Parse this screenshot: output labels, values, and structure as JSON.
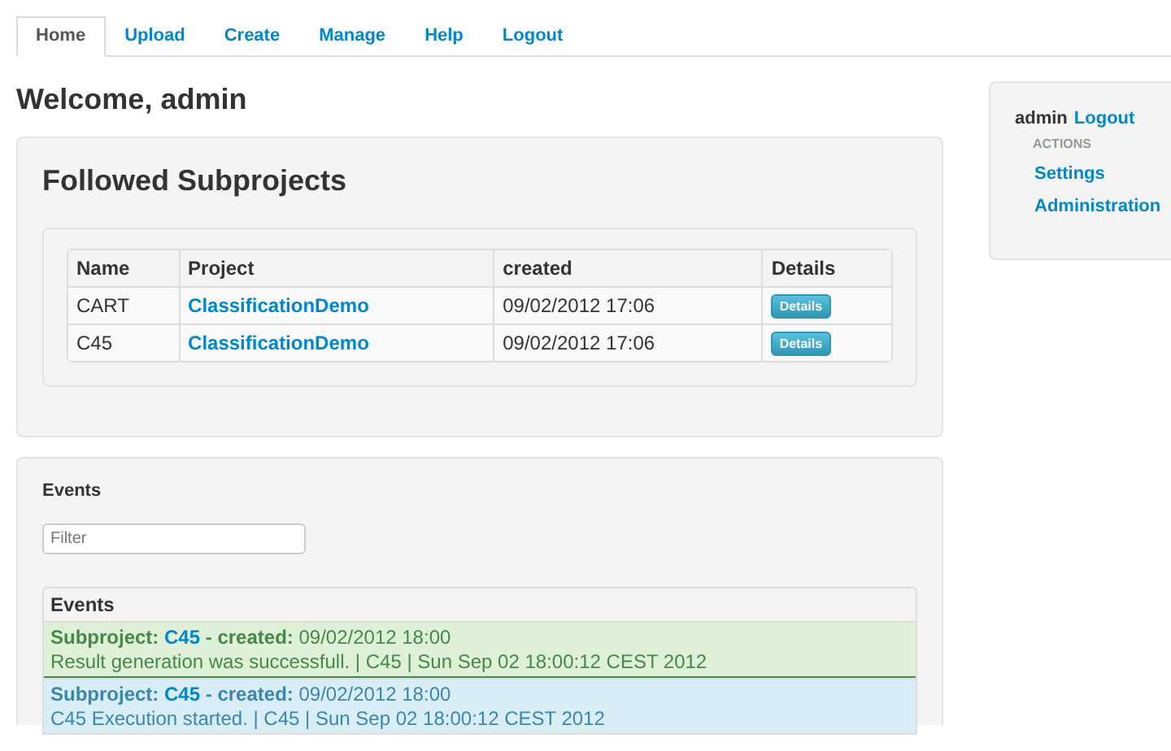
{
  "nav": {
    "tabs": [
      {
        "label": "Home",
        "selected": true
      },
      {
        "label": "Upload",
        "selected": false
      },
      {
        "label": "Create",
        "selected": false
      },
      {
        "label": "Manage",
        "selected": false
      },
      {
        "label": "Help",
        "selected": false
      },
      {
        "label": "Logout",
        "selected": false
      }
    ]
  },
  "heading": "Welcome, admin",
  "followed": {
    "title": "Followed Subprojects",
    "columns": [
      "Name",
      "Project",
      "created",
      "Details"
    ],
    "rows": [
      {
        "name": "CART",
        "project": "ClassificationDemo",
        "created": "09/02/2012 17:06",
        "button": "Details"
      },
      {
        "name": "C45",
        "project": "ClassificationDemo",
        "created": "09/02/2012 17:06",
        "button": "Details"
      }
    ]
  },
  "events": {
    "title": "Events",
    "filter": {
      "placeholder": "Filter"
    },
    "table_heading": "Events",
    "items": [
      {
        "kind": "success",
        "label": "Subproject:",
        "subproject": "C45",
        "action": "- created:",
        "time": "09/02/2012 18:00",
        "message": "Result generation was successfull. | C45 | Sun Sep 02 18:00:12 CEST 2012"
      },
      {
        "kind": "info",
        "label": "Subproject:",
        "subproject": "C45",
        "action": "- created:",
        "time": "09/02/2012 18:00",
        "message": "C45 Execution started. | C45 | Sun Sep 02 18:00:12 CEST 2012"
      }
    ]
  },
  "sidebar": {
    "user": "admin",
    "logout": "Logout",
    "section": "ACTIONS",
    "links": [
      "Settings",
      "Administration"
    ]
  }
}
